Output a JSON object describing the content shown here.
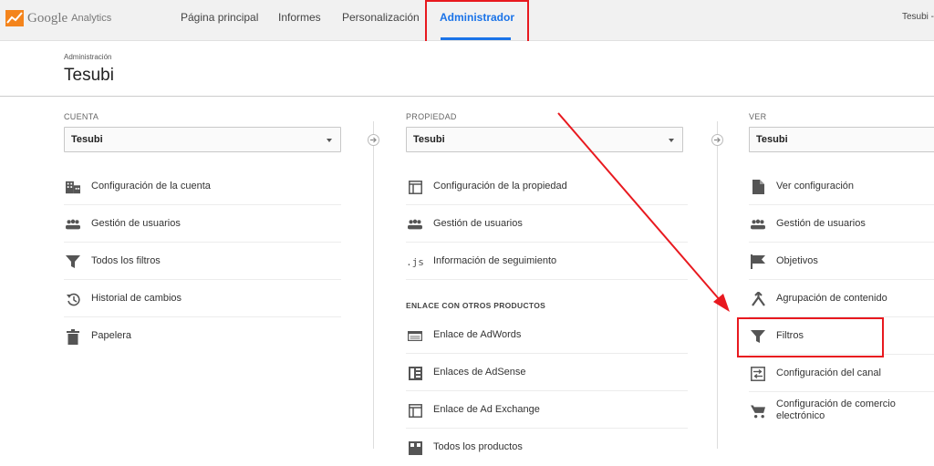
{
  "app": {
    "logo_google": "Google",
    "logo_analytics": "Analytics"
  },
  "nav": {
    "items": [
      {
        "label": "Página principal"
      },
      {
        "label": "Informes"
      },
      {
        "label": "Personalización"
      },
      {
        "label": "Administrador",
        "active": true
      }
    ],
    "user": "Tesubi -"
  },
  "header": {
    "breadcrumb": "Administración",
    "title": "Tesubi"
  },
  "columns": {
    "cuenta": {
      "label": "CUENTA",
      "selected": "Tesubi",
      "items": [
        {
          "label": "Configuración de la cuenta",
          "icon": "building-icon"
        },
        {
          "label": "Gestión de usuarios",
          "icon": "users-icon"
        },
        {
          "label": "Todos los filtros",
          "icon": "filter-icon"
        },
        {
          "label": "Historial de cambios",
          "icon": "history-icon"
        },
        {
          "label": "Papelera",
          "icon": "trash-icon"
        }
      ]
    },
    "propiedad": {
      "label": "PROPIEDAD",
      "selected": "Tesubi",
      "items": [
        {
          "label": "Configuración de la propiedad",
          "icon": "window-icon"
        },
        {
          "label": "Gestión de usuarios",
          "icon": "users-icon"
        },
        {
          "label": "Información de seguimiento",
          "icon": "js-icon",
          "icon_text": ".js"
        }
      ],
      "section_title": "ENLACE CON OTROS PRODUCTOS",
      "linked": [
        {
          "label": "Enlace de AdWords",
          "icon": "adwords-icon"
        },
        {
          "label": "Enlaces de AdSense",
          "icon": "adsense-icon"
        },
        {
          "label": "Enlace de Ad Exchange",
          "icon": "adexchange-icon"
        },
        {
          "label": "Todos los productos",
          "icon": "products-icon"
        }
      ]
    },
    "ver": {
      "label": "VER",
      "selected": "Tesubi",
      "items": [
        {
          "label": "Ver configuración",
          "icon": "document-icon"
        },
        {
          "label": "Gestión de usuarios",
          "icon": "users-icon"
        },
        {
          "label": "Objetivos",
          "icon": "flag-icon"
        },
        {
          "label": "Agrupación de contenido",
          "icon": "grouping-icon"
        },
        {
          "label": "Filtros",
          "icon": "filter-icon"
        },
        {
          "label": "Configuración del canal",
          "icon": "channel-icon"
        },
        {
          "label": "Configuración de comercio electrónico",
          "icon": "cart-icon"
        }
      ]
    }
  },
  "colors": {
    "accent": "#1a73e8",
    "annotation": "#e8191f",
    "icon": "#555555"
  }
}
